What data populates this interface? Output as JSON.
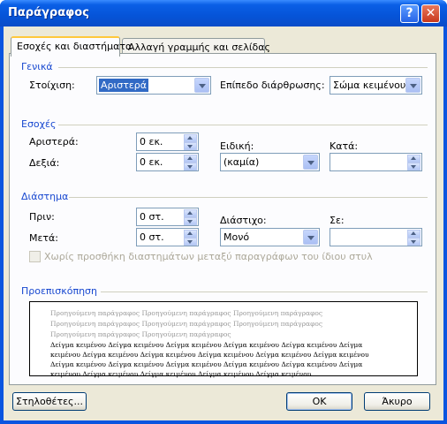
{
  "dialog": {
    "title": "Παράγραφος",
    "help_label": "?",
    "close_label": "✕"
  },
  "tabs": [
    {
      "label": "Εσοχές και διαστήματα",
      "active": true
    },
    {
      "label": "Αλλαγή γραμμής και σελίδας",
      "active": false
    }
  ],
  "general": {
    "section_title": "Γενικά",
    "alignment_label": "Στοίχιση:",
    "alignment_value": "Αριστερά",
    "outline_label": "Επίπεδο διάρθρωσης:",
    "outline_value": "Σώμα κειμένου"
  },
  "indentation": {
    "section_title": "Εσοχές",
    "left_label": "Αριστερά:",
    "left_value": "0 εκ.",
    "right_label": "Δεξιά:",
    "right_value": "0 εκ.",
    "special_label": "Ειδική:",
    "special_value": "(καμία)",
    "by_label": "Κατά:",
    "by_value": ""
  },
  "spacing": {
    "section_title": "Διάστημα",
    "before_label": "Πριν:",
    "before_value": "0 στ.",
    "after_label": "Μετά:",
    "after_value": "0 στ.",
    "line_spacing_label": "Διάστιχο:",
    "line_spacing_value": "Μονό",
    "at_label": "Σε:",
    "at_value": "",
    "no_space_checkbox_label": "Χωρίς προσθήκη διαστημάτων μεταξύ παραγράφων του ίδιου στυλ"
  },
  "preview": {
    "section_title": "Προεπισκόπηση",
    "previous_lines": [
      "Προηγούμενη παράγραφος Προηγούμενη παράγραφος Προηγούμενη παράγραφος",
      "Προηγούμενη παράγραφος Προηγούμενη παράγραφος Προηγούμενη παράγραφος",
      "Προηγούμενη παράγραφος Προηγούμενη παράγραφος"
    ],
    "sample_lines": [
      "Δείγμα κειμένου Δείγμα κειμένου Δείγμα κειμένου Δείγμα κειμένου Δείγμα κειμένου Δείγμα",
      "κειμένου Δείγμα κειμένου Δείγμα κειμένου Δείγμα κειμένου Δείγμα κειμένου Δείγμα κειμένου",
      "Δείγμα κειμένου Δείγμα κειμένου Δείγμα κειμένου Δείγμα κειμένου Δείγμα κειμένου Δείγμα",
      "κειμένου Δείγμα κειμένου Δείγμα κειμένου Δείγμα κειμένου Δείγμα κειμένου"
    ]
  },
  "buttons": {
    "tabs_label": "Στηλοθέτες...",
    "ok_label": "OK",
    "cancel_label": "Άκυρο"
  },
  "colors": {
    "title_bar": "#0a5fe6",
    "section_heading": "#1848d0",
    "dialog_face": "#ece9d8"
  }
}
